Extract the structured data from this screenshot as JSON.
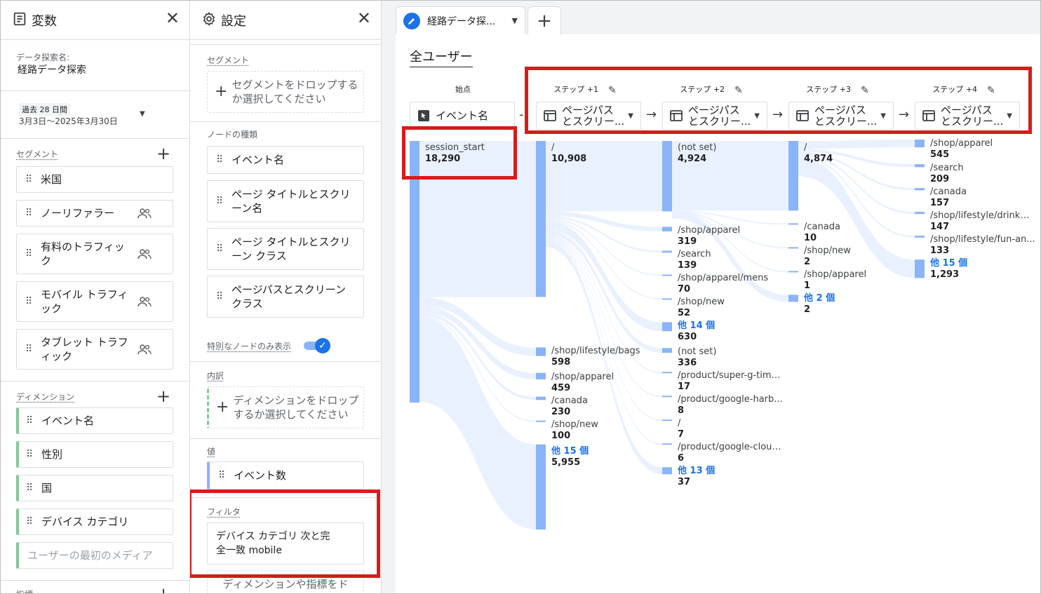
{
  "variables_panel": {
    "title": "変数",
    "close_label": "✕",
    "exploration_name_label": "データ探索名:",
    "exploration_name": "経路データ探索",
    "date_range_badge": "過去 28 日間",
    "date_range": "3月3日～2025年3月30日",
    "segments_label": "セグメント",
    "segments": [
      "米国",
      "ノーリファラー",
      "有料のトラフィック",
      "モバイル トラフィック",
      "タブレット トラフィック"
    ],
    "dimensions_label": "ディメンション",
    "dimensions": [
      "イベント名",
      "性別",
      "国",
      "デバイス カテゴリ"
    ],
    "dimension_placeholder": "ユーザーの最初のメディア",
    "metrics_label": "指標"
  },
  "settings_panel": {
    "title": "設定",
    "close_label": "✕",
    "segment_label": "セグメント",
    "segment_drop": "セグメントをドロップするか選択してください",
    "node_type_label": "ノードの種類",
    "node_types": [
      "イベント名",
      "ページ タイトルとスクリーン名",
      "ページ タイトルとスクリーン クラス",
      "ページパスとスクリーン クラス"
    ],
    "special_nodes_label": "特別なノードのみ表示",
    "breakdown_label": "内訳",
    "breakdown_drop": "ディメンションをドロップするか選択してください",
    "value_label": "値",
    "value_chip": "イベント数",
    "filter_label": "フィルタ",
    "filter_line1": "デバイス カテゴリ 次と完",
    "filter_line2": "全一致 mobile",
    "filter_drop": "ディメンションや指標をド"
  },
  "canvas": {
    "tab_label": "経路データ探...",
    "tab_add": "+",
    "viz_title": "全ユーザー",
    "start_label": "始点",
    "start_selector": "イベント名",
    "steps": [
      {
        "label": "ステップ +1",
        "selector_line1": "ページパス",
        "selector_line2": "とスクリー..."
      },
      {
        "label": "ステップ +2",
        "selector_line1": "ページパス",
        "selector_line2": "とスクリー..."
      },
      {
        "label": "ステップ +3",
        "selector_line1": "ページパス",
        "selector_line2": "とスクリー..."
      },
      {
        "label": "ステップ +4",
        "selector_line1": "ページパス",
        "selector_line2": "とスクリー..."
      }
    ],
    "columns": [
      {
        "nodes": [
          {
            "label": "session_start",
            "value": "18,290",
            "count": 18290
          }
        ]
      },
      {
        "nodes": [
          {
            "label": "/",
            "value": "10,908",
            "count": 10908
          },
          {
            "label": "/shop/lifestyle/bags",
            "value": "598",
            "count": 598
          },
          {
            "label": "/shop/apparel",
            "value": "459",
            "count": 459
          },
          {
            "label": "/canada",
            "value": "230",
            "count": 230
          },
          {
            "label": "/shop/new",
            "value": "100",
            "count": 100
          },
          {
            "label": "他 15 個",
            "value": "5,955",
            "count": 5955,
            "more": true
          }
        ]
      },
      {
        "nodes": [
          {
            "label": "(not set)",
            "value": "4,924",
            "count": 4924
          },
          {
            "label": "/shop/apparel",
            "value": "319",
            "count": 319
          },
          {
            "label": "/search",
            "value": "139",
            "count": 139
          },
          {
            "label": "/shop/apparel/mens",
            "value": "70",
            "count": 70
          },
          {
            "label": "/shop/new",
            "value": "52",
            "count": 52
          },
          {
            "label": "他 14 個",
            "value": "630",
            "count": 630,
            "more": true
          },
          {
            "label": "(not set)",
            "value": "336",
            "count": 336
          },
          {
            "label": "/product/super-g-timb...",
            "value": "17",
            "count": 17
          },
          {
            "label": "/product/google-harb...",
            "value": "8",
            "count": 8
          },
          {
            "label": "/",
            "value": "7",
            "count": 7
          },
          {
            "label": "/product/google-cloud...",
            "value": "6",
            "count": 6
          },
          {
            "label": "他 13 個",
            "value": "37",
            "count": 37,
            "more": true
          }
        ]
      },
      {
        "nodes": [
          {
            "label": "/",
            "value": "4,874",
            "count": 4874
          },
          {
            "label": "/canada",
            "value": "10",
            "count": 10
          },
          {
            "label": "/shop/new",
            "value": "2",
            "count": 2
          },
          {
            "label": "/shop/apparel",
            "value": "1",
            "count": 1
          },
          {
            "label": "他 2 個",
            "value": "2",
            "count": 2,
            "more": true
          }
        ]
      },
      {
        "nodes": [
          {
            "label": "/shop/apparel",
            "value": "545",
            "count": 545
          },
          {
            "label": "/search",
            "value": "209",
            "count": 209
          },
          {
            "label": "/canada",
            "value": "157",
            "count": 157
          },
          {
            "label": "/shop/lifestyle/drinkw...",
            "value": "147",
            "count": 147
          },
          {
            "label": "/shop/lifestyle/fun-an...",
            "value": "133",
            "count": 133
          },
          {
            "label": "他 15 個",
            "value": "1,293",
            "count": 1293,
            "more": true
          }
        ]
      }
    ]
  },
  "colors": {
    "node_bar": "#8ab4f8",
    "flow": "#e8f0fe",
    "highlight": "#d81b1b",
    "accent": "#1a73e8"
  }
}
